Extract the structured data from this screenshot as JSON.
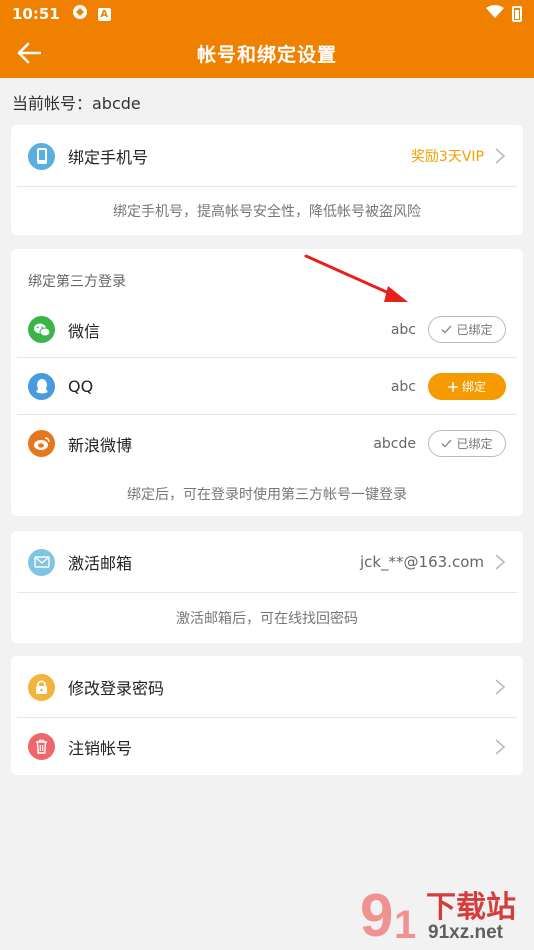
{
  "status": {
    "time": "10:51"
  },
  "appbar": {
    "title": "帐号和绑定设置"
  },
  "account": {
    "label": "当前帐号：abcde"
  },
  "phone": {
    "label": "绑定手机号",
    "reward": "奖励3天VIP",
    "hint": "绑定手机号，提高帐号安全性，降低帐号被盗风险"
  },
  "third_party": {
    "title": "绑定第三方登录",
    "items": [
      {
        "label": "微信",
        "value": "abc",
        "action": "已绑定",
        "bound": true
      },
      {
        "label": "QQ",
        "value": "abc",
        "action": "绑定",
        "bound": false
      },
      {
        "label": "新浪微博",
        "value": "abcde",
        "action": "已绑定",
        "bound": true
      }
    ],
    "hint": "绑定后，可在登录时使用第三方帐号一键登录"
  },
  "email": {
    "label": "激活邮箱",
    "value": "jck_**@163.com",
    "hint": "激活邮箱后，可在线找回密码"
  },
  "security": {
    "change_password": "修改登录密码",
    "delete_account": "注销帐号"
  },
  "watermark": {
    "brand": "下载站",
    "domain": "91xz.net"
  },
  "colors": {
    "brand": "#f08100",
    "reward": "#f0a000",
    "bind_button": "#f59a00",
    "wechat": "#3bb54a",
    "qq": "#4a9ae0",
    "weibo": "#e8771c"
  }
}
